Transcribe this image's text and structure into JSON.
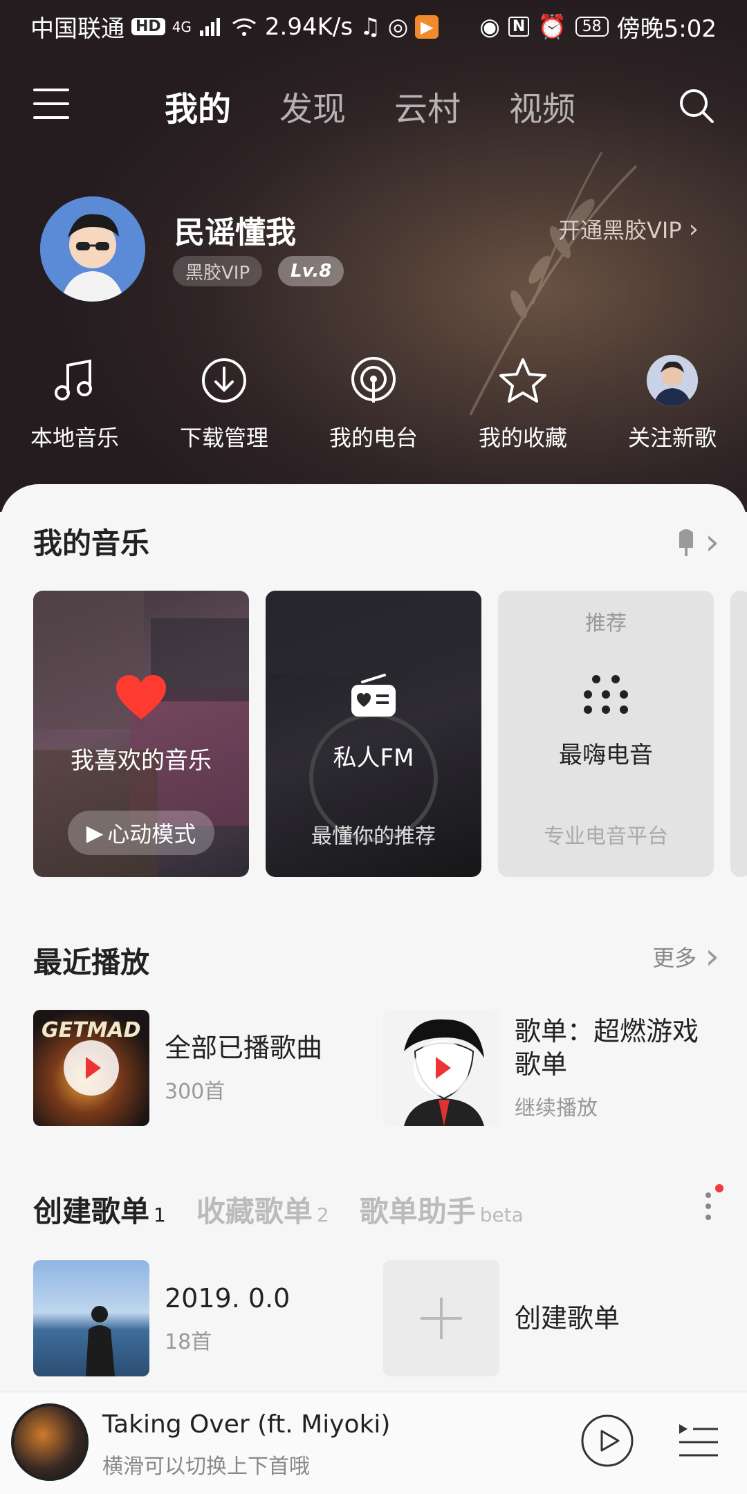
{
  "status_bar": {
    "carrier": "中国联通",
    "hd": "HD",
    "network": "4G",
    "speed": "2.94K/s",
    "battery": "58",
    "time": "傍晚5:02"
  },
  "nav": {
    "tabs": [
      {
        "label": "我的",
        "active": true
      },
      {
        "label": "发现",
        "active": false
      },
      {
        "label": "云村",
        "active": false
      },
      {
        "label": "视频",
        "active": false
      }
    ]
  },
  "profile": {
    "name": "民谣懂我",
    "vip_badge": "黑胶VIP",
    "level": "Lv.8",
    "vip_link": "开通黑胶VIP"
  },
  "quick_menu": [
    {
      "label": "本地音乐",
      "icon": "music-note-icon"
    },
    {
      "label": "下载管理",
      "icon": "download-icon"
    },
    {
      "label": "我的电台",
      "icon": "radio-podcast-icon"
    },
    {
      "label": "我的收藏",
      "icon": "star-icon"
    },
    {
      "label": "关注新歌",
      "icon": "artist-avatar"
    }
  ],
  "my_music": {
    "title": "我的音乐",
    "cards": {
      "favorite": {
        "label": "我喜欢的音乐",
        "button": "心动模式"
      },
      "fm": {
        "label": "私人FM",
        "sub": "最懂你的推荐"
      },
      "recommend": {
        "top": "推荐",
        "label": "最嗨电音",
        "sub": "专业电音平台"
      }
    }
  },
  "recent": {
    "title": "最近播放",
    "more": "更多",
    "items": [
      {
        "title": "全部已播歌曲",
        "sub": "300首"
      },
      {
        "title": "歌单：超燃游戏歌单",
        "sub": "继续播放"
      }
    ]
  },
  "playlists": {
    "tabs": [
      {
        "label": "创建歌单",
        "count": "1",
        "active": true
      },
      {
        "label": "收藏歌单",
        "count": "2",
        "active": false
      },
      {
        "label": "歌单助手",
        "count": "beta",
        "active": false
      }
    ],
    "items": [
      {
        "title": "2019. 0.0",
        "sub": "18首"
      },
      {
        "title": "创建歌单"
      }
    ]
  },
  "player": {
    "title": "Taking Over (ft. Miyoki)",
    "subtitle": "横滑可以切换上下首哦"
  },
  "colors": {
    "accent": "#ee3b3b",
    "header_dark": "#2f2426"
  }
}
